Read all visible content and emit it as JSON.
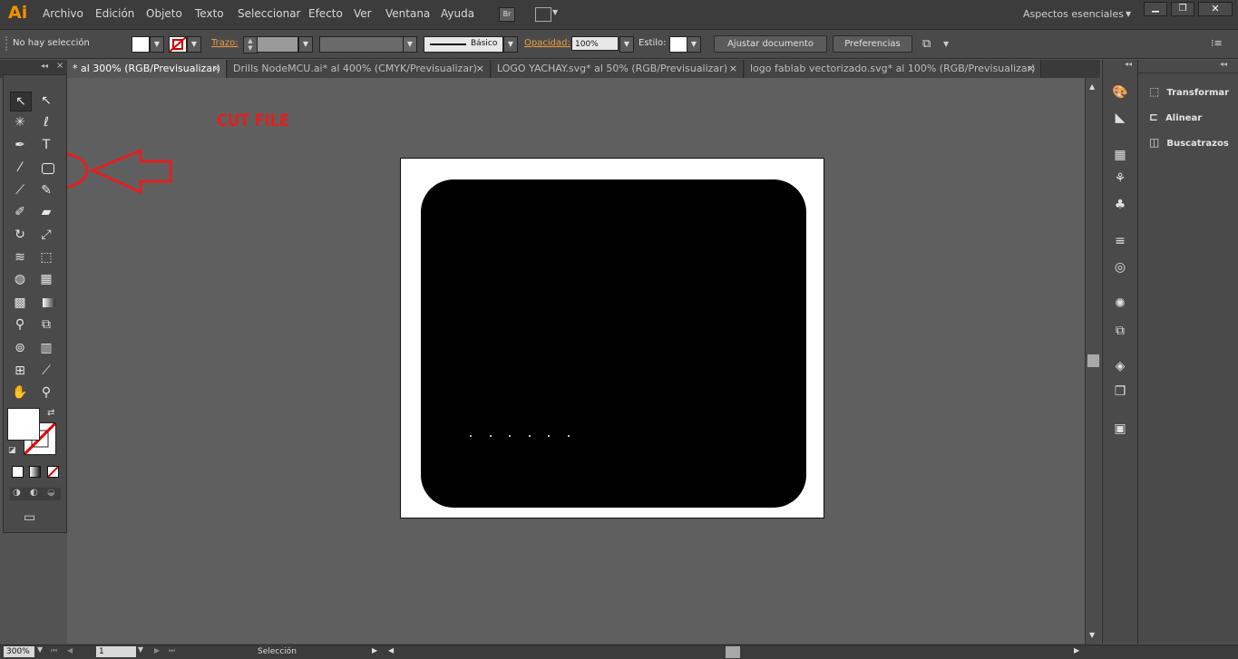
{
  "app": {
    "logo": "Ai",
    "workspace": "Aspectos esenciales"
  },
  "menu": [
    "Archivo",
    "Edición",
    "Objeto",
    "Texto",
    "Seleccionar",
    "Efecto",
    "Ver",
    "Ventana",
    "Ayuda"
  ],
  "menu_icons": {
    "bridge": "Br"
  },
  "control": {
    "selection": "No hay selección",
    "stroke_label": "Trazo:",
    "brush_label": "Básico",
    "opacity_label": "Opacidad:",
    "opacity_value": "100%",
    "style_label": "Estilo:",
    "doc_setup": "Ajustar documento",
    "preferences": "Preferencias"
  },
  "tabs": [
    {
      "label": "* al 300% (RGB/Previsualizar)",
      "active": true
    },
    {
      "label": "Drills NodeMCU.ai* al 400% (CMYK/Previsualizar)",
      "active": false
    },
    {
      "label": "LOGO YACHAY.svg* al 50% (RGB/Previsualizar)",
      "active": false
    },
    {
      "label": "logo fablab vectorizado.svg* al 100% (RGB/Previsualizar)",
      "active": false
    }
  ],
  "tab_close": "×",
  "annotation": {
    "text": "CUT FILE",
    "color": "#e02020"
  },
  "artboard": {
    "dot_count": 6
  },
  "panels": [
    {
      "label": "Transformar"
    },
    {
      "label": "Alinear"
    },
    {
      "label": "Buscatrazos"
    }
  ],
  "status": {
    "zoom": "300%",
    "page": "1",
    "tool": "Selección"
  },
  "colors": {
    "accent_orange": "#f29200",
    "annotation_red": "#e02020",
    "artwork": "#000000"
  }
}
